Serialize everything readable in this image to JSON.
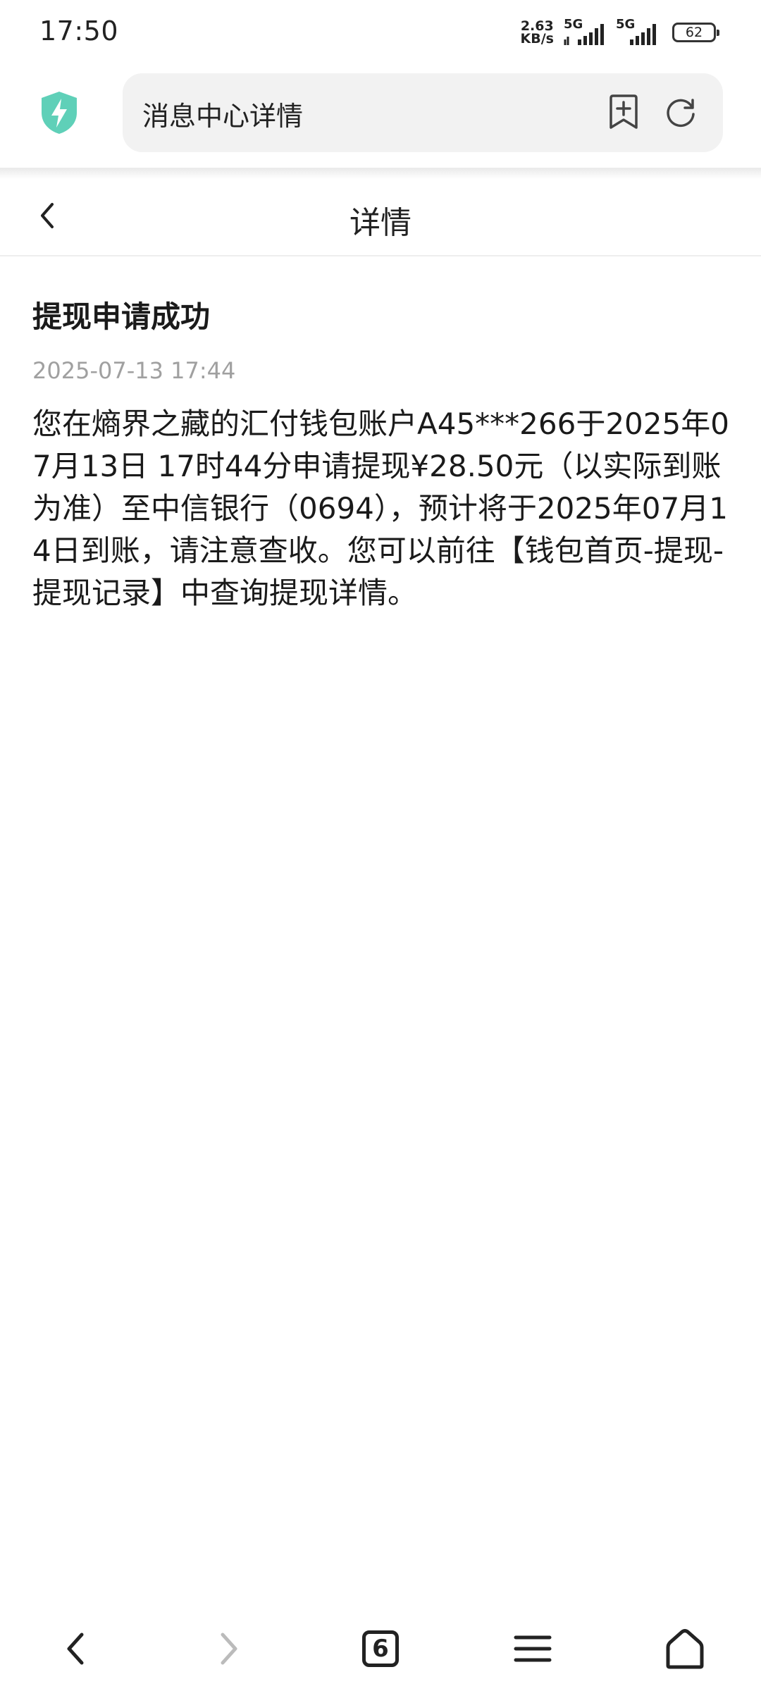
{
  "status_bar": {
    "time": "17:50",
    "net_speed_value": "2.63",
    "net_speed_unit": "KB/s",
    "signal_1_label": "5G",
    "signal_2_label": "5G",
    "battery_level": "62"
  },
  "browser": {
    "address_text": "消息中心详情",
    "shield_color": "#5fd0b8"
  },
  "header": {
    "title": "详情"
  },
  "message": {
    "title": "提现申请成功",
    "timestamp": "2025-07-13 17:44",
    "body": "您在熵界之藏的汇付钱包账户A45***266于2025年07月13日 17时44分申请提现¥28.50元（以实际到账为准）至中信银行（0694），预计将于2025年07月14日到账，请注意查收。您可以前往【钱包首页-提现-提现记录】中查询提现详情。"
  },
  "bottom_nav": {
    "tab_count": "6",
    "items": [
      "back-icon",
      "forward-icon",
      "tabs-icon",
      "menu-icon",
      "home-icon"
    ]
  }
}
